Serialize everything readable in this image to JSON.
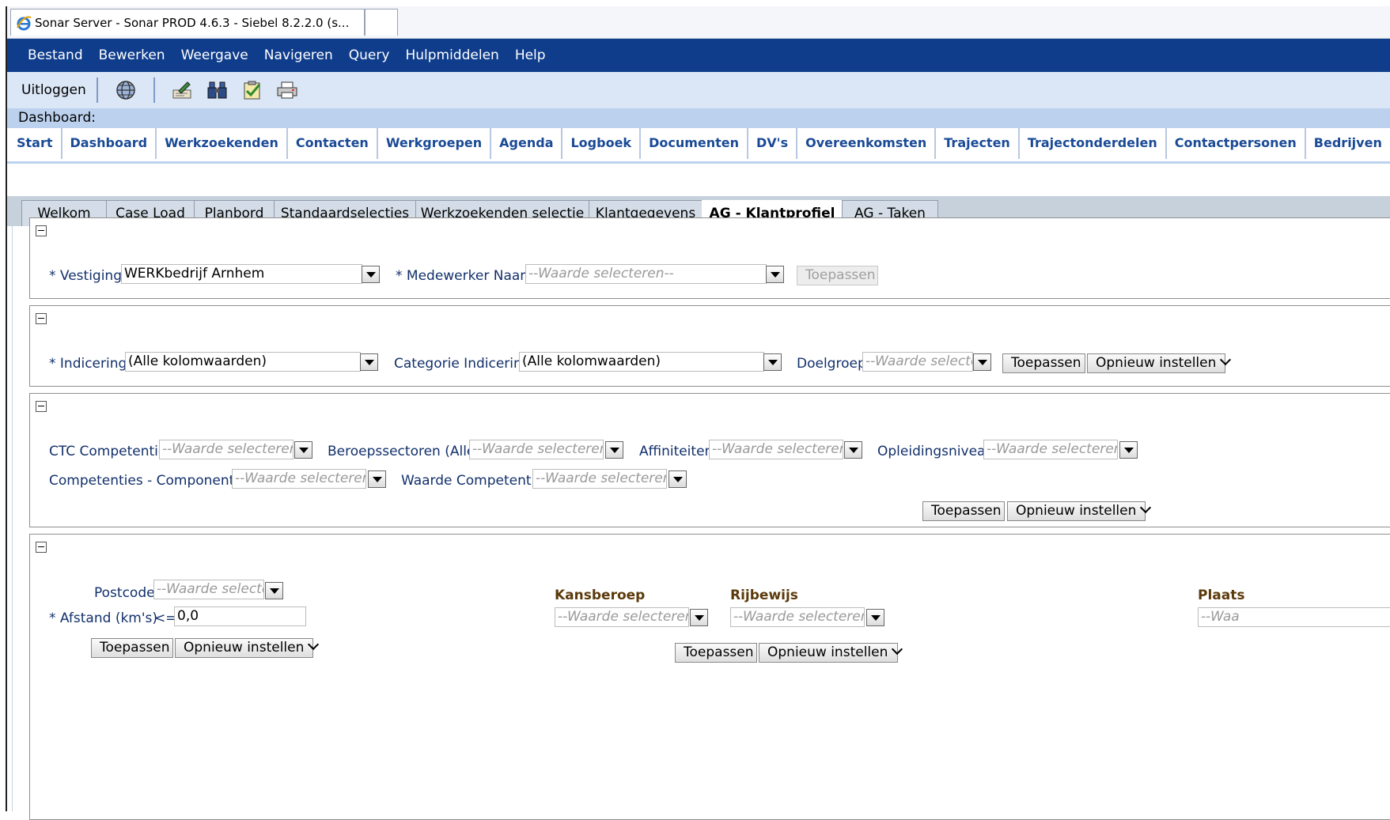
{
  "browser": {
    "tab_title": "Sonar Server - Sonar PROD 4.6.3 - Siebel 8.2.2.0 (s..."
  },
  "menu": [
    "Bestand",
    "Bewerken",
    "Weergave",
    "Navigeren",
    "Query",
    "Hulpmiddelen",
    "Help"
  ],
  "toolbar": {
    "logout": "Uitloggen"
  },
  "dashboard_label": "Dashboard:",
  "screen_tabs": [
    "Start",
    "Dashboard",
    "Werkzoekenden",
    "Contacten",
    "Werkgroepen",
    "Agenda",
    "Logboek",
    "Documenten",
    "DV's",
    "Overeenkomsten",
    "Trajecten",
    "Trajectonderdelen",
    "Contactpersonen",
    "Bedrijven"
  ],
  "view_tabs": [
    "Welkom",
    "Case Load",
    "Planbord",
    "Standaardselecties",
    "Werkzoekenden selectie",
    "Klantgegevens",
    "AG - Klantprofiel",
    "AG - Taken"
  ],
  "active_view_tab": "AG - Klantprofiel",
  "panel1": {
    "vestiging_label": "* Vestiging",
    "vestiging_value": "WERKbedrijf Arnhem",
    "medewerker_label": "* Medewerker Naam",
    "medewerker_placeholder": "--Waarde selecteren--",
    "apply": "Toepassen"
  },
  "panel2": {
    "indicering_label": "* Indicering",
    "indicering_value": "(Alle kolomwaarden)",
    "categorie_label": "Categorie Indicering",
    "categorie_value": "(Alle kolomwaarden)",
    "doelgroep_label": "Doelgroep",
    "doelgroep_placeholder": "--Waarde selecte",
    "apply": "Toepassen",
    "reset": "Opnieuw instellen"
  },
  "panel3": {
    "ctc_label": "CTC Competentie",
    "ctc_placeholder": "--Waarde selecteren--",
    "beroep_label": "Beroepssectoren (Alle)",
    "beroep_placeholder": "--Waarde selecteren--",
    "affiniteiten_label": "Affiniteiten",
    "affiniteiten_placeholder": "--Waarde selecteren--",
    "opleiding_label": "Opleidingsniveau",
    "opleiding_placeholder": "--Waarde selecteren--",
    "componenten_label": "Competenties - Componenten",
    "componenten_placeholder": "--Waarde selecteren--",
    "waarde_label": "Waarde Competentie",
    "waarde_placeholder": "--Waarde selecteren--",
    "apply": "Toepassen",
    "reset": "Opnieuw instellen"
  },
  "panel4": {
    "postcode_label": "Postcode",
    "postcode_placeholder": "--Waarde selecte",
    "afstand_label": "* Afstand (km's)",
    "afstand_op": "<=",
    "afstand_value": "0,0",
    "apply_left": "Toepassen",
    "reset_left": "Opnieuw instellen",
    "kansberoep_label": "Kansberoep",
    "kansberoep_placeholder": "--Waarde selecteren--",
    "rijbewijs_label": "Rijbewijs",
    "rijbewijs_placeholder": "--Waarde selecteren--",
    "apply_mid": "Toepassen",
    "reset_mid": "Opnieuw instellen",
    "plaats_label": "Plaats",
    "plaats_placeholder": "--Waa"
  },
  "colors": {
    "menu_bg": "#0f3d8c",
    "tab_text": "#1a4a96",
    "label_text": "#12306b",
    "bold_label": "#5b3a0b"
  }
}
